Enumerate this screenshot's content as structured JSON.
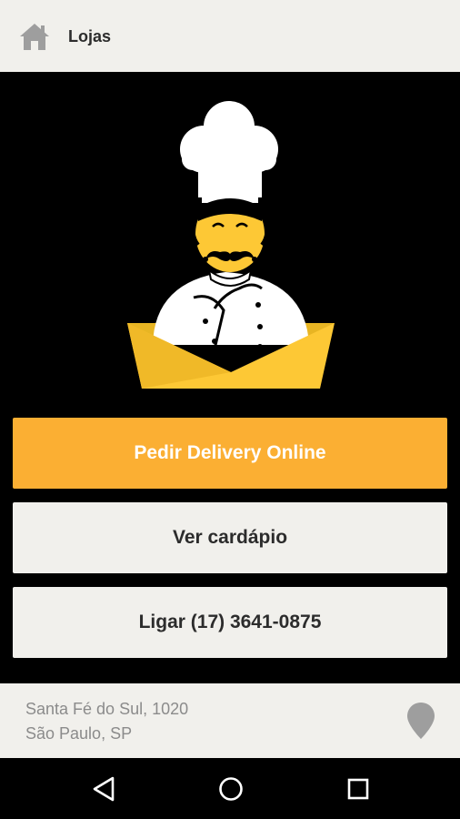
{
  "header": {
    "title": "Lojas",
    "home_icon": "home-icon"
  },
  "logo": {
    "icon": "chef-logo"
  },
  "actions": {
    "delivery_label": "Pedir Delivery Online",
    "menu_label": "Ver cardápio",
    "call_label": "Ligar (17) 3641-0875"
  },
  "address": {
    "line1": "Santa Fé do Sul, 1020",
    "line2": "São Paulo, SP",
    "icon": "map-pin-icon"
  },
  "navbar": {
    "back_icon": "back-icon",
    "home_icon": "home-circle-icon",
    "recents_icon": "recents-icon"
  },
  "colors": {
    "accent": "#fbaf33",
    "logo_yellow": "#fdc835",
    "panel": "#f1f0ec",
    "text_dark": "#2c2c2c",
    "text_muted": "#8b8b8b"
  }
}
